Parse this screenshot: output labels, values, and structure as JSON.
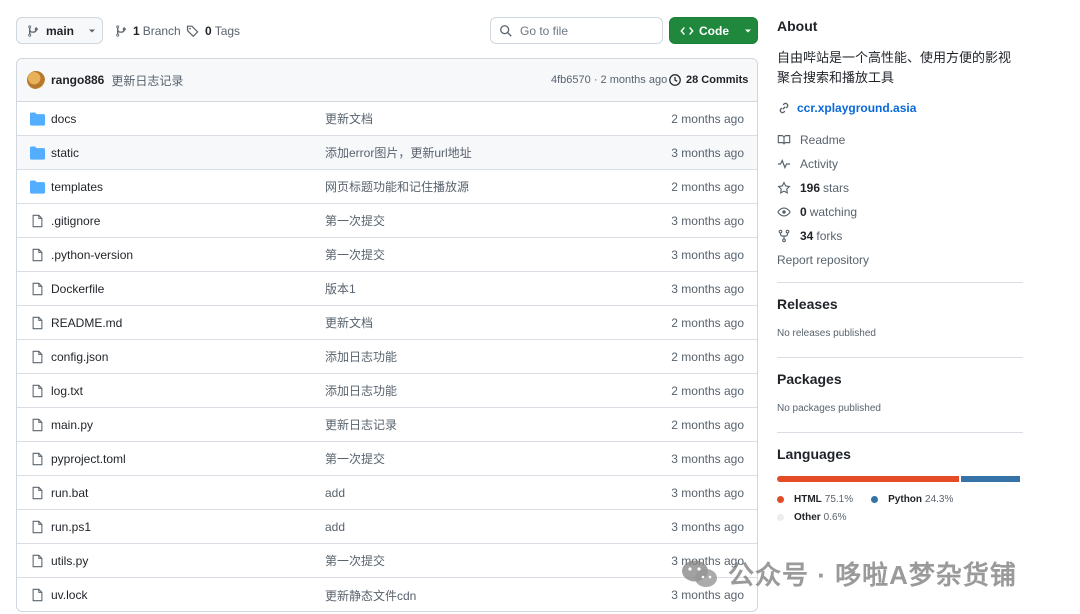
{
  "toolbar": {
    "branch_label": "main",
    "branches_count": "1",
    "branches_label": "Branch",
    "tags_count": "0",
    "tags_label": "Tags",
    "goto_placeholder": "Go to file",
    "code_label": "Code",
    "code_color": "#1f883d"
  },
  "commit": {
    "author": "rango886",
    "message": "更新日志记录",
    "hash_age": "4fb6570 · 2 months ago",
    "commits_count": "28 Commits"
  },
  "files": [
    {
      "type": "folder",
      "name": "docs",
      "message": "更新文档",
      "date": "2 months ago"
    },
    {
      "type": "folder",
      "name": "static",
      "message": "添加error图片，更新url地址",
      "date": "3 months ago"
    },
    {
      "type": "folder",
      "name": "templates",
      "message": "网页标题功能和记住播放源",
      "date": "2 months ago"
    },
    {
      "type": "file",
      "name": ".gitignore",
      "message": "第一次提交",
      "date": "3 months ago"
    },
    {
      "type": "file",
      "name": ".python-version",
      "message": "第一次提交",
      "date": "3 months ago"
    },
    {
      "type": "file",
      "name": "Dockerfile",
      "message": "版本1",
      "date": "3 months ago"
    },
    {
      "type": "file",
      "name": "README.md",
      "message": "更新文档",
      "date": "2 months ago"
    },
    {
      "type": "file",
      "name": "config.json",
      "message": "添加日志功能",
      "date": "2 months ago"
    },
    {
      "type": "file",
      "name": "log.txt",
      "message": "添加日志功能",
      "date": "2 months ago"
    },
    {
      "type": "file",
      "name": "main.py",
      "message": "更新日志记录",
      "date": "2 months ago"
    },
    {
      "type": "file",
      "name": "pyproject.toml",
      "message": "第一次提交",
      "date": "3 months ago"
    },
    {
      "type": "file",
      "name": "run.bat",
      "message": "add",
      "date": "3 months ago"
    },
    {
      "type": "file",
      "name": "run.ps1",
      "message": "add",
      "date": "3 months ago"
    },
    {
      "type": "file",
      "name": "utils.py",
      "message": "第一次提交",
      "date": "3 months ago"
    },
    {
      "type": "file",
      "name": "uv.lock",
      "message": "更新静态文件cdn",
      "date": "3 months ago"
    }
  ],
  "about": {
    "title": "About",
    "description": "自由哔站是一个高性能、使用方便的影视聚合搜索和播放工具",
    "website": "ccr.xplayground.asia",
    "readme": "Readme",
    "activity": "Activity",
    "stars_count": "196",
    "stars_label": "stars",
    "watching_count": "0",
    "watching_label": "watching",
    "forks_count": "34",
    "forks_label": "forks",
    "report": "Report repository"
  },
  "releases": {
    "title": "Releases",
    "note": "No releases published"
  },
  "packages": {
    "title": "Packages",
    "note": "No packages published"
  },
  "languages": {
    "title": "Languages",
    "items": [
      {
        "name": "HTML",
        "percent": "75.1%",
        "value": 75.1,
        "color": "#e34c26"
      },
      {
        "name": "Python",
        "percent": "24.3%",
        "value": 24.3,
        "color": "#3572A5"
      },
      {
        "name": "Other",
        "percent": "0.6%",
        "value": 0.6,
        "color": "#ededed"
      }
    ]
  },
  "watermark": {
    "text": "公众号 · 哆啦A梦杂货铺"
  }
}
